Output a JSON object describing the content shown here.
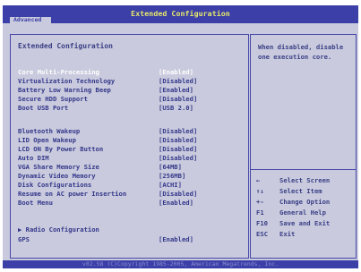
{
  "header": {
    "title": "Extended Configuration",
    "active_tab": "Advanced"
  },
  "main": {
    "section_title": "Extended Configuration",
    "items": [
      {
        "label": "Core Multi-Processing",
        "value": "[Enabled]"
      },
      {
        "label": "Virtualization Technology",
        "value": "[Disabled]"
      },
      {
        "label": "Battery Low Warning Beep",
        "value": "[Enabled]"
      },
      {
        "label": "Secure HDD Support",
        "value": "[Disabled]"
      },
      {
        "label": "Boot USB Port",
        "value": "[USB 2.0]"
      },
      {
        "label": "Bluetooth Wakeup",
        "value": "[Disabled]"
      },
      {
        "label": "LID Open Wakeup",
        "value": "[Disabled]"
      },
      {
        "label": "LCD ON By Power Button",
        "value": "[Disabled]"
      },
      {
        "label": "Auto DIM",
        "value": "[Disabled]"
      },
      {
        "label": "VGA Share Memory Size",
        "value": "[64MB]"
      },
      {
        "label": "Dynamic Video Memory",
        "value": "[256MB]"
      },
      {
        "label": "Disk Configurations",
        "value": "[ACHI]"
      },
      {
        "label": "Resume on AC power Insertion",
        "value": "[Disabled]"
      },
      {
        "label": "Boot Menu",
        "value": "[Enabled]"
      },
      {
        "label": "▶ Radio Configuration",
        "value": ""
      },
      {
        "label": "GPS",
        "value": "[Enabled]"
      }
    ]
  },
  "help": {
    "text": "When disabled, disable one execution core.",
    "keys": [
      {
        "key": "←",
        "desc": "Select Screen"
      },
      {
        "key": "↑↓",
        "desc": "Select Item"
      },
      {
        "key": "+-",
        "desc": "Change Option"
      },
      {
        "key": "F1",
        "desc": "General Help"
      },
      {
        "key": "F10",
        "desc": "Save and Exit"
      },
      {
        "key": "ESC",
        "desc": "Exit"
      }
    ]
  },
  "footer": {
    "text": "v02.58 (C)Copyright 1985-2005, American Megatrends, Inc."
  }
}
